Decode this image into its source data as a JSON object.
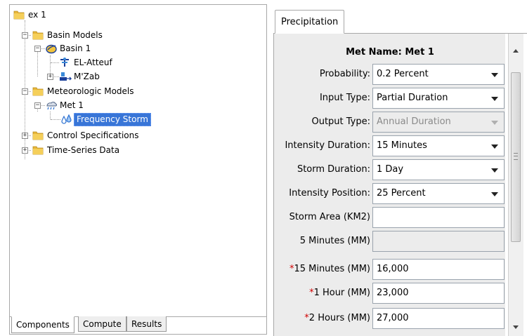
{
  "tree": {
    "root": "ex 1",
    "basin_models": "Basin Models",
    "basin_1": "Basin 1",
    "el_atteuf": "EL-Atteuf",
    "mzab": "M'Zab",
    "meteorologic_models": "Meteorologic Models",
    "met_1": "Met 1",
    "frequency_storm": "Frequency Storm",
    "control_specifications": "Control Specifications",
    "time_series_data": "Time-Series Data"
  },
  "left_tabs": [
    "Components",
    "Compute",
    "Results"
  ],
  "right_tab": "Precipitation",
  "form": {
    "met_name_label": "Met Name:",
    "met_name_value": "Met 1",
    "probability_label": "Probability:",
    "probability_value": "0.2 Percent",
    "input_type_label": "Input Type:",
    "input_type_value": "Partial Duration",
    "output_type_label": "Output Type:",
    "output_type_value": "Annual Duration",
    "intensity_duration_label": "Intensity Duration:",
    "intensity_duration_value": "15 Minutes",
    "storm_duration_label": "Storm Duration:",
    "storm_duration_value": "1 Day",
    "intensity_position_label": "Intensity Position:",
    "intensity_position_value": "25 Percent",
    "storm_area_label": "Storm Area (KM2)",
    "storm_area_value": "",
    "min5_label": "5 Minutes (MM)",
    "min5_value": "",
    "min15_label": "15 Minutes (MM)",
    "min15_value": "16,000",
    "hour1_label": "1 Hour (MM)",
    "hour1_value": "23,000",
    "hour2_label": "2 Hours (MM)",
    "hour2_value": "27,000",
    "required_mark": "*"
  },
  "colors": {
    "selection": "#3875d7",
    "required": "#d00000",
    "form_background": "#ececec"
  }
}
